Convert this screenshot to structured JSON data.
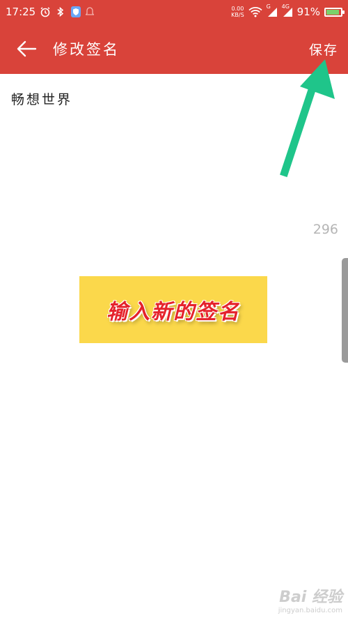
{
  "status_bar": {
    "time": "17:25",
    "net_speed_value": "0.00",
    "net_speed_unit": "KB/S",
    "signal_2g_label": "G",
    "signal_4g_label": "4G",
    "battery_percent": "91%",
    "battery_level": 0.91
  },
  "app_bar": {
    "title": "修改签名",
    "save_label": "保存"
  },
  "editor": {
    "signature_value": "畅想世界",
    "remaining_count": "296"
  },
  "annotation": {
    "text": "输入新的签名"
  },
  "watermark": {
    "logo": "Bai 经验",
    "url": "jingyan.baidu.com"
  },
  "colors": {
    "app_bar": "#d9433a",
    "annotation_bg": "#fbd84b",
    "annotation_text": "#e5222b",
    "arrow": "#1fc58a"
  }
}
